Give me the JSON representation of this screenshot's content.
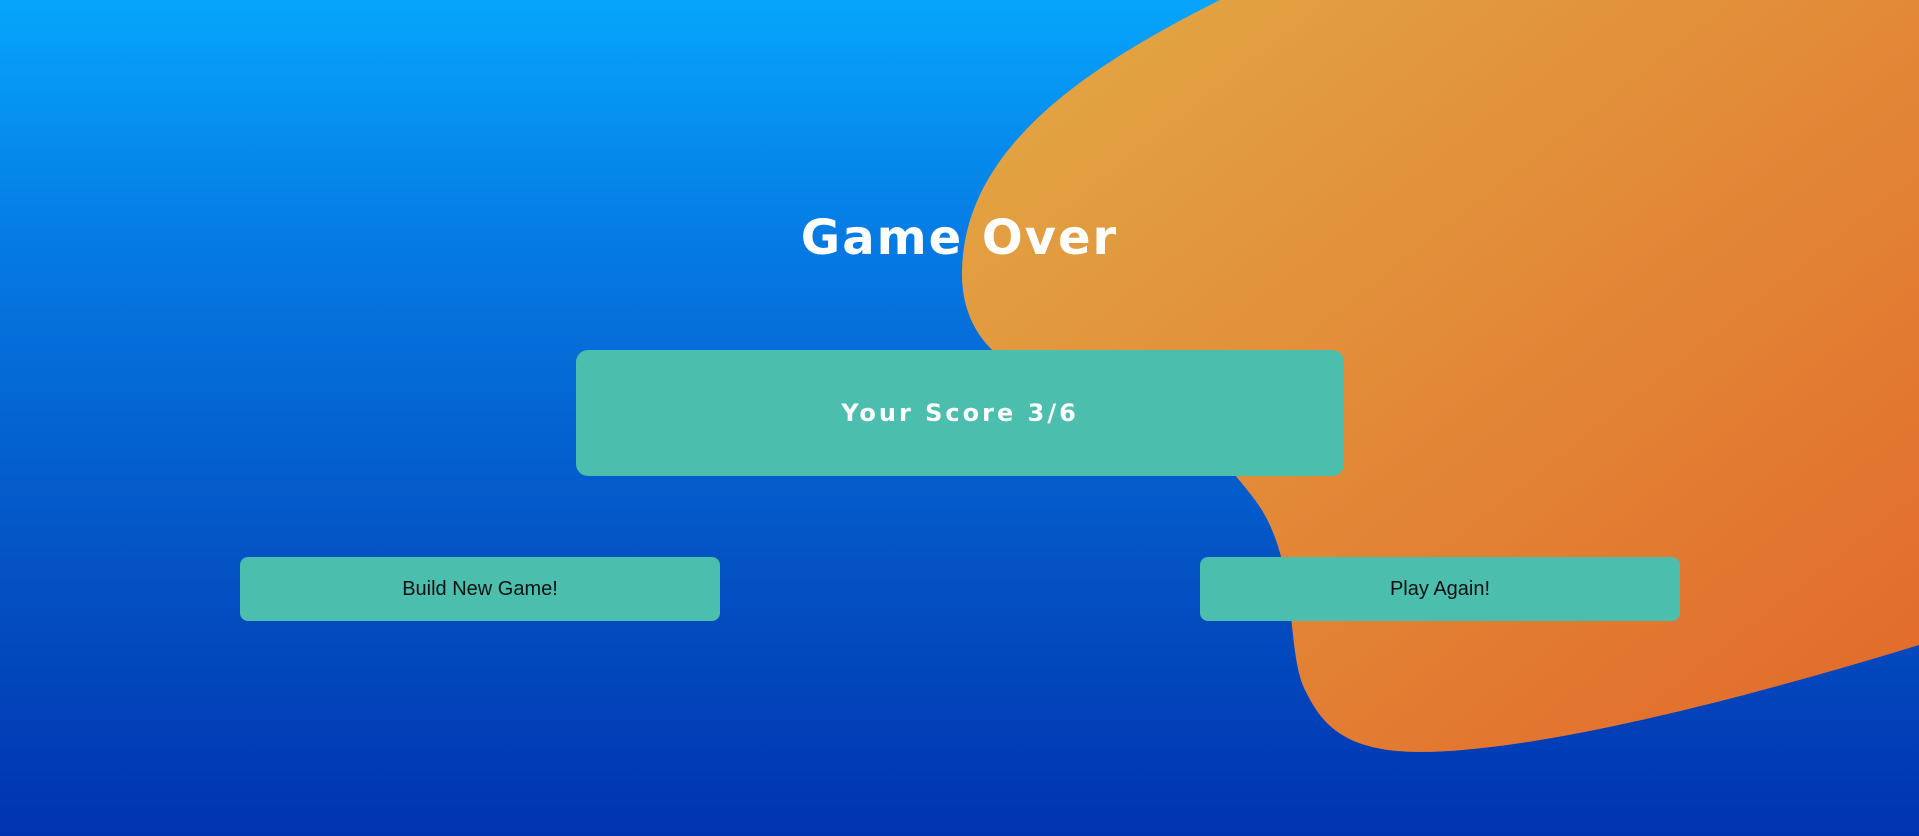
{
  "game_over": {
    "title": "Game Over",
    "score_text": "Your Score 3/6",
    "build_new_game_label": "Build New Game!",
    "play_again_label": "Play Again!"
  },
  "colors": {
    "background_top": "#06a5fc",
    "background_bottom": "#0033b0",
    "blob_start": "#e2aa45",
    "blob_end": "#e2682a",
    "card": "#4bbead",
    "title_text": "#ffffff",
    "button_text": "#111111"
  }
}
